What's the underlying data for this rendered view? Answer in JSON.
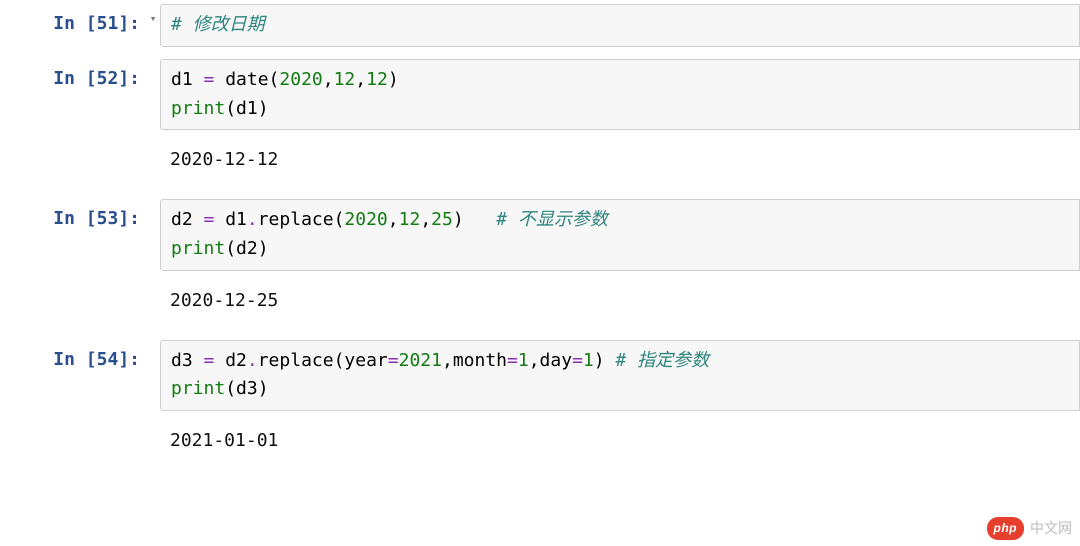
{
  "cells": [
    {
      "prompt_number": 51,
      "prompt_text": "In [51]:",
      "has_collapse": true,
      "code_tokens": [
        {
          "t": "# 修改日期",
          "cls": "c-comment"
        }
      ],
      "output": null
    },
    {
      "prompt_number": 52,
      "prompt_text": "In [52]:",
      "has_collapse": false,
      "code_tokens": [
        {
          "t": "d1 ",
          "cls": "c-var"
        },
        {
          "t": "=",
          "cls": "c-op"
        },
        {
          "t": " date",
          "cls": "c-var"
        },
        {
          "t": "(",
          "cls": "c-paren"
        },
        {
          "t": "2020",
          "cls": "c-num"
        },
        {
          "t": ",",
          "cls": "c-paren"
        },
        {
          "t": "12",
          "cls": "c-num"
        },
        {
          "t": ",",
          "cls": "c-paren"
        },
        {
          "t": "12",
          "cls": "c-num"
        },
        {
          "t": ")",
          "cls": "c-paren"
        },
        {
          "t": "\n",
          "cls": ""
        },
        {
          "t": "print",
          "cls": "c-builtin"
        },
        {
          "t": "(",
          "cls": "c-paren"
        },
        {
          "t": "d1",
          "cls": "c-var"
        },
        {
          "t": ")",
          "cls": "c-paren"
        }
      ],
      "output": "2020-12-12"
    },
    {
      "prompt_number": 53,
      "prompt_text": "In [53]:",
      "has_collapse": false,
      "code_tokens": [
        {
          "t": "d2 ",
          "cls": "c-var"
        },
        {
          "t": "=",
          "cls": "c-op"
        },
        {
          "t": " d1",
          "cls": "c-var"
        },
        {
          "t": ".",
          "cls": "c-op"
        },
        {
          "t": "replace",
          "cls": "c-var"
        },
        {
          "t": "(",
          "cls": "c-paren"
        },
        {
          "t": "2020",
          "cls": "c-num"
        },
        {
          "t": ",",
          "cls": "c-paren"
        },
        {
          "t": "12",
          "cls": "c-num"
        },
        {
          "t": ",",
          "cls": "c-paren"
        },
        {
          "t": "25",
          "cls": "c-num"
        },
        {
          "t": ")   ",
          "cls": "c-paren"
        },
        {
          "t": "# 不显示参数",
          "cls": "c-comment"
        },
        {
          "t": "\n",
          "cls": ""
        },
        {
          "t": "print",
          "cls": "c-builtin"
        },
        {
          "t": "(",
          "cls": "c-paren"
        },
        {
          "t": "d2",
          "cls": "c-var"
        },
        {
          "t": ")",
          "cls": "c-paren"
        }
      ],
      "output": "2020-12-25"
    },
    {
      "prompt_number": 54,
      "prompt_text": "In [54]:",
      "has_collapse": false,
      "code_tokens": [
        {
          "t": "d3 ",
          "cls": "c-var"
        },
        {
          "t": "=",
          "cls": "c-op"
        },
        {
          "t": " d2",
          "cls": "c-var"
        },
        {
          "t": ".",
          "cls": "c-op"
        },
        {
          "t": "replace",
          "cls": "c-var"
        },
        {
          "t": "(",
          "cls": "c-paren"
        },
        {
          "t": "year",
          "cls": "c-kwarg"
        },
        {
          "t": "=",
          "cls": "c-op"
        },
        {
          "t": "2021",
          "cls": "c-num"
        },
        {
          "t": ",",
          "cls": "c-paren"
        },
        {
          "t": "month",
          "cls": "c-kwarg"
        },
        {
          "t": "=",
          "cls": "c-op"
        },
        {
          "t": "1",
          "cls": "c-num"
        },
        {
          "t": ",",
          "cls": "c-paren"
        },
        {
          "t": "day",
          "cls": "c-kwarg"
        },
        {
          "t": "=",
          "cls": "c-op"
        },
        {
          "t": "1",
          "cls": "c-num"
        },
        {
          "t": ") ",
          "cls": "c-paren"
        },
        {
          "t": "# 指定参数",
          "cls": "c-comment"
        },
        {
          "t": "\n",
          "cls": ""
        },
        {
          "t": "print",
          "cls": "c-builtin"
        },
        {
          "t": "(",
          "cls": "c-paren"
        },
        {
          "t": "d3",
          "cls": "c-var"
        },
        {
          "t": ")",
          "cls": "c-paren"
        }
      ],
      "output": "2021-01-01"
    }
  ],
  "watermark": {
    "badge": "php",
    "text": "中文网"
  },
  "collapse_glyph": "▾"
}
